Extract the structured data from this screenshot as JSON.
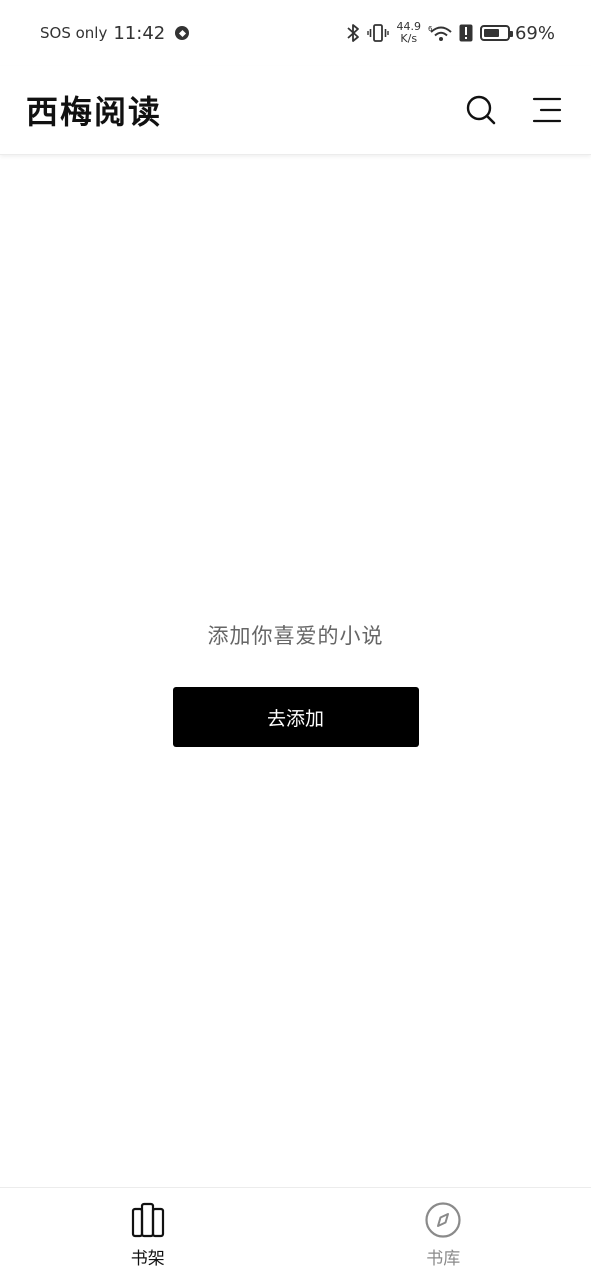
{
  "status_bar": {
    "carrier": "SOS only",
    "time": "11:42",
    "net_speed_value": "44.9",
    "net_speed_unit": "K/s",
    "battery_percent_text": "69%",
    "battery_level": 0.69,
    "icons": [
      "shield-icon",
      "bluetooth-icon",
      "vibrate-icon",
      "wifi-icon",
      "alert-icon",
      "battery-icon"
    ]
  },
  "app_bar": {
    "title": "西梅阅读",
    "actions": [
      "search-icon",
      "menu-icon"
    ]
  },
  "empty_state": {
    "message": "添加你喜爱的小说",
    "button_label": "去添加"
  },
  "bottom_nav": {
    "tabs": [
      {
        "label": "书架",
        "icon": "bookshelf-icon",
        "active": true
      },
      {
        "label": "书库",
        "icon": "compass-icon",
        "active": false
      }
    ]
  },
  "colors": {
    "primary_button": "#000000",
    "active_tab": "#111111",
    "inactive_tab": "#8a8a8a",
    "empty_text": "#666666"
  }
}
